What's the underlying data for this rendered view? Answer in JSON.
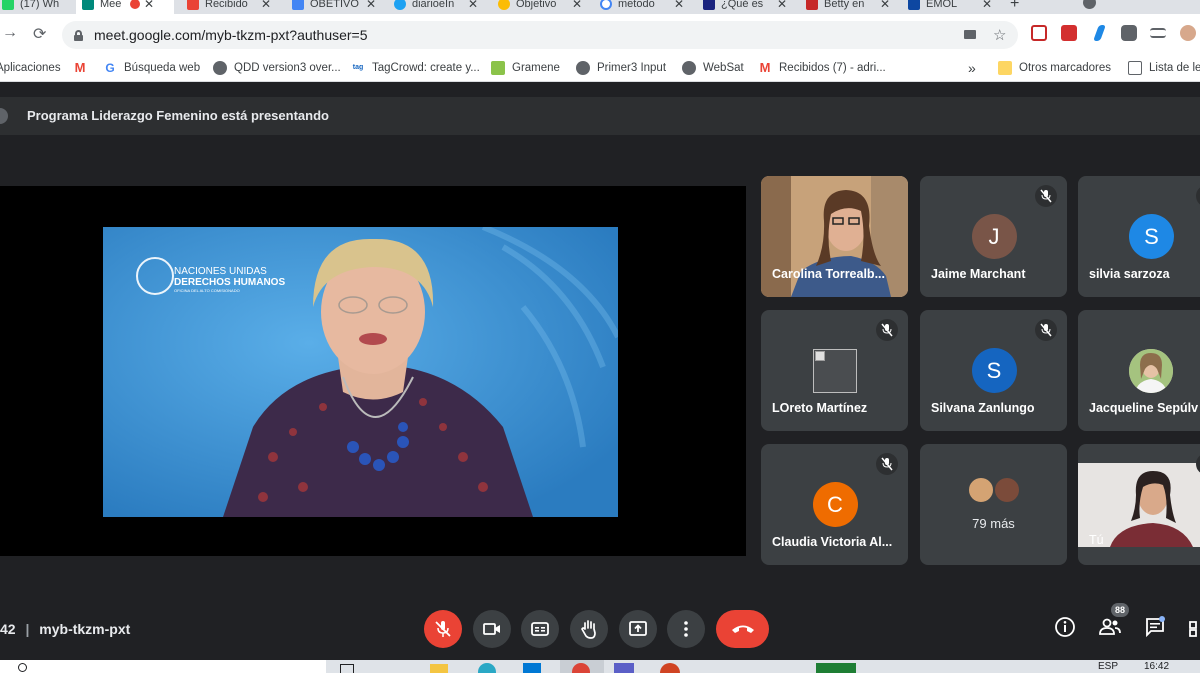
{
  "browser": {
    "tabs": [
      {
        "label": "(17) Wh",
        "color": "#25d366"
      },
      {
        "label": "Mee",
        "color": "#00897b"
      },
      {
        "label": "Recibido",
        "color": "#ea4335"
      },
      {
        "label": "OBETIVO",
        "color": "#4285f4"
      },
      {
        "label": "diarioeIn",
        "color": "#1da1f2"
      },
      {
        "label": "Objetivo",
        "color": "#fbbc04"
      },
      {
        "label": "metodo",
        "color": "#4285f4"
      },
      {
        "label": "¿Qué es",
        "color": "#1a237e"
      },
      {
        "label": "Betty en",
        "color": "#c62828"
      },
      {
        "label": "EMOL",
        "color": "#0d47a1"
      }
    ],
    "new_tab": "+",
    "url": "meet.google.com/myb-tkzm-pxt?authuser=5",
    "bookmarks": [
      {
        "label": "Aplicaciones",
        "icon": "apps-icon"
      },
      {
        "label": "",
        "icon": "gmail-icon"
      },
      {
        "label": "Búsqueda web",
        "icon": "google-icon"
      },
      {
        "label": "QDD version3 over...",
        "icon": "globe-icon"
      },
      {
        "label": "TagCrowd: create y...",
        "icon": "tagcrowd-icon"
      },
      {
        "label": "Gramene",
        "icon": "gramene-icon"
      },
      {
        "label": "Primer3 Input",
        "icon": "globe-icon"
      },
      {
        "label": "WebSat",
        "icon": "globe-icon"
      },
      {
        "label": "Recibidos (7) - adri...",
        "icon": "gmail-icon"
      },
      {
        "label": "»",
        "icon": ""
      },
      {
        "label": "Otros marcadores",
        "icon": "folder-icon"
      },
      {
        "label": "Lista de le",
        "icon": "reading-list-icon"
      }
    ]
  },
  "meet": {
    "presenting_text": "Programa Liderazgo Femenino está presentando",
    "slide_logo": {
      "line1": "NACIONES UNIDAS",
      "line2": "DERECHOS HUMANOS",
      "line3": "OFICINA DEL ALTO COMISIONADO"
    },
    "participants": [
      {
        "name": "Carolina Torrealb...",
        "type": "video"
      },
      {
        "name": "Jaime Marchant",
        "initial": "J",
        "color": "#795548",
        "muted": true
      },
      {
        "name": "silvia sarzoza",
        "initial": "S",
        "color": "#1e88e5",
        "muted": true
      },
      {
        "name": "LOreto Martínez",
        "type": "image",
        "muted": true
      },
      {
        "name": "Silvana Zanlungo",
        "initial": "S",
        "color": "#1565c0",
        "muted": true
      },
      {
        "name": "Jacqueline Sepúlv",
        "type": "photo",
        "muted": true
      },
      {
        "name": "Claudia Victoria Al...",
        "initial": "C",
        "color": "#ef6c00",
        "muted": true
      },
      {
        "name": "79 más",
        "type": "more"
      },
      {
        "name": "Tú",
        "type": "self-video"
      }
    ],
    "time_fragment": "42",
    "meeting_code": "myb-tkzm-pxt",
    "people_count": "88"
  },
  "taskbar": {
    "language": "ESP",
    "time": "16:42"
  }
}
